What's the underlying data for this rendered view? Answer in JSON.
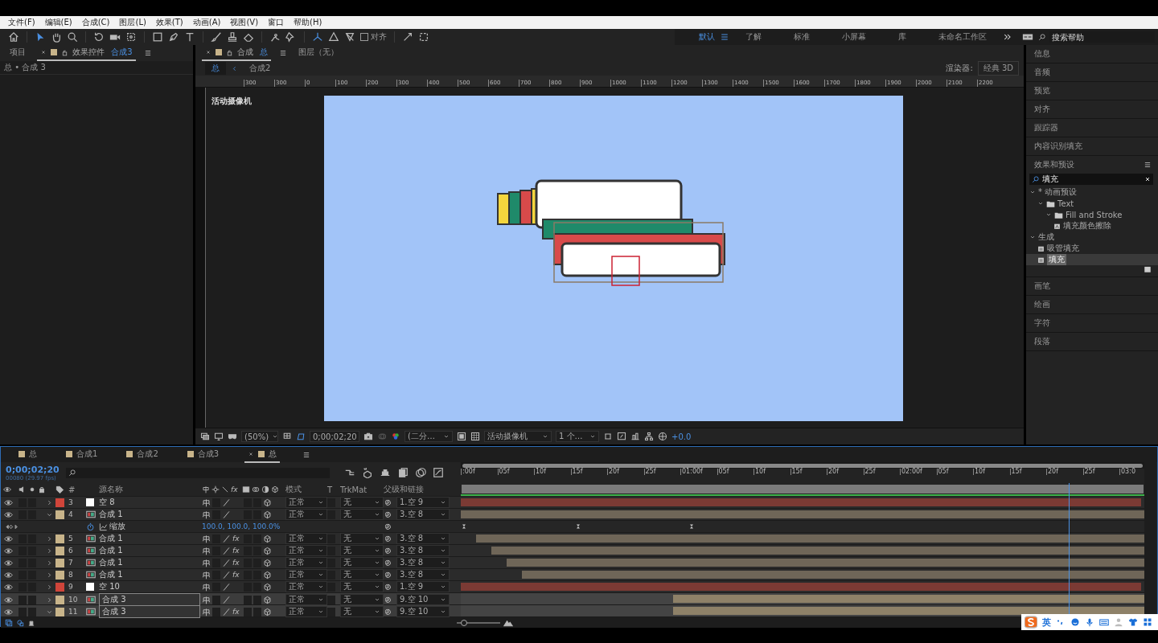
{
  "menu_bar": [
    "文件(F)",
    "编辑(E)",
    "合成(C)",
    "图层(L)",
    "效果(T)",
    "动画(A)",
    "视图(V)",
    "窗口",
    "帮助(H)"
  ],
  "toolbar": {
    "snap_label": "对齐",
    "snap_checked": false
  },
  "workspaces": [
    {
      "label": "默认",
      "selected": true
    },
    {
      "label": "了解",
      "selected": false
    },
    {
      "label": "标准",
      "selected": false
    },
    {
      "label": "小屏幕",
      "selected": false
    },
    {
      "label": "库",
      "selected": false
    },
    {
      "label": "未命名工作区",
      "selected": false
    }
  ],
  "search_help": {
    "placeholder": "搜索帮助"
  },
  "left_panel": {
    "tabs": [
      {
        "label": "项目",
        "selected": false
      },
      {
        "label": "效果控件",
        "target": "合成3",
        "selected": true
      }
    ],
    "breadcrumb": "总 • 合成 3"
  },
  "comp_panel": {
    "tabs": [
      {
        "label": "合成",
        "target": "总",
        "selected": true
      },
      {
        "label": "图层（无）",
        "selected": false
      }
    ],
    "breadcrumbs": [
      {
        "label": "总",
        "selected": true
      },
      {
        "label": "合成2",
        "selected": false
      }
    ],
    "renderer_label": "渲染器:",
    "renderer": "经典 3D",
    "ruler_labels": [
      "300",
      "300",
      "0",
      "100",
      "200",
      "300",
      "400",
      "500",
      "600",
      "700",
      "800",
      "900",
      "1000",
      "1100",
      "1200",
      "1300",
      "1400",
      "1500",
      "1600",
      "1700",
      "1800",
      "1900",
      "2000",
      "2100",
      "2200"
    ],
    "camera_label": "活动摄像机",
    "footer": {
      "zoom": "(50%)",
      "timecode": "0;00;02;20",
      "resolution": "(二分…",
      "camera": "活动摄像机",
      "views": "1 个…",
      "exposure": "+0.0"
    }
  },
  "right_panels": [
    {
      "title": "信息",
      "expanded": false
    },
    {
      "title": "音频",
      "expanded": false
    },
    {
      "title": "预览",
      "expanded": false
    },
    {
      "title": "对齐",
      "expanded": false
    },
    {
      "title": "跟踪器",
      "expanded": false
    },
    {
      "title": "内容识别填充",
      "expanded": false
    },
    {
      "title": "效果和预设",
      "expanded": true,
      "search_value": "填充",
      "tree": [
        {
          "label": "* 动画预设",
          "kind": "category",
          "expanded": true,
          "selected": false,
          "children": [
            {
              "label": "Text",
              "kind": "folder",
              "expanded": true,
              "selected": false,
              "children": [
                {
                  "label": "Fill and Stroke",
                  "kind": "folder",
                  "expanded": true,
                  "selected": false,
                  "children": [
                    {
                      "label": "填充颜色擦除",
                      "kind": "preset",
                      "selected": false
                    }
                  ]
                }
              ]
            }
          ]
        },
        {
          "label": "生成",
          "kind": "category",
          "expanded": true,
          "selected": false,
          "children": [
            {
              "label": "吸管填充",
              "kind": "effect",
              "selected": false
            },
            {
              "label": "填充",
              "kind": "effect",
              "selected": true
            }
          ]
        }
      ]
    },
    {
      "title": "画笔",
      "expanded": false
    },
    {
      "title": "绘画",
      "expanded": false
    },
    {
      "title": "字符",
      "expanded": false
    },
    {
      "title": "段落",
      "expanded": false
    }
  ],
  "timeline": {
    "tabs": [
      {
        "label": "总",
        "color": "#c8b48a",
        "selected": false
      },
      {
        "label": "合成1",
        "color": "#c8b48a",
        "selected": false
      },
      {
        "label": "合成2",
        "color": "#c8b48a",
        "selected": false
      },
      {
        "label": "合成3",
        "color": "#c8b48a",
        "selected": false
      },
      {
        "label": "总",
        "color": "#c8b48a",
        "selected": true
      }
    ],
    "timecode": "0;00;02;20",
    "frame_info": "00080 (29.97 fps)",
    "columns": {
      "number": "#",
      "source_name": "源名称",
      "fx": "fx",
      "mode": "模式",
      "t": "T",
      "trkmat": "TrkMat",
      "parent": "父级和链接"
    },
    "ruler_labels": [
      ":00f",
      "05f",
      "10f",
      "15f",
      "20f",
      "25f",
      "01:00f",
      "05f",
      "10f",
      "15f",
      "20f",
      "25f",
      "02:00f",
      "05f",
      "10f",
      "15f",
      "20f",
      "25f",
      "03:0"
    ],
    "layers": [
      {
        "number": "3",
        "color": "#d0453a",
        "kind": "null",
        "name": "空 8",
        "expanded": false,
        "selected": false,
        "mode": "正常",
        "trkmat": "无",
        "parent": "1.空 9"
      },
      {
        "number": "4",
        "color": "#c8b48a",
        "kind": "comp",
        "name": "合成 1",
        "expanded": true,
        "selected": false,
        "mode": "正常",
        "trkmat": "无",
        "parent": "3.空 8",
        "properties": [
          {
            "name": "缩放",
            "value": "100.0, 100.0, 100.0%"
          }
        ]
      },
      {
        "number": "5",
        "color": "#c8b48a",
        "kind": "comp",
        "name": "合成 1",
        "expanded": false,
        "selected": false,
        "effects": "fx",
        "mode": "正常",
        "trkmat": "无",
        "parent": "3.空 8"
      },
      {
        "number": "6",
        "color": "#c8b48a",
        "kind": "comp",
        "name": "合成 1",
        "expanded": false,
        "selected": false,
        "effects": "fx",
        "mode": "正常",
        "trkmat": "无",
        "parent": "3.空 8"
      },
      {
        "number": "7",
        "color": "#c8b48a",
        "kind": "comp",
        "name": "合成 1",
        "expanded": false,
        "selected": false,
        "effects": "fx",
        "mode": "正常",
        "trkmat": "无",
        "parent": "3.空 8"
      },
      {
        "number": "8",
        "color": "#c8b48a",
        "kind": "comp",
        "name": "合成 1",
        "expanded": false,
        "selected": false,
        "effects": "fx",
        "mode": "正常",
        "trkmat": "无",
        "parent": "3.空 8"
      },
      {
        "number": "9",
        "color": "#d0453a",
        "kind": "null",
        "name": "空 10",
        "expanded": false,
        "selected": false,
        "mode": "正常",
        "trkmat": "无",
        "parent": "1.空 9"
      },
      {
        "number": "10",
        "color": "#c8b48a",
        "kind": "comp",
        "name": "合成 3",
        "expanded": false,
        "selected": true,
        "mode": "正常",
        "trkmat": "无",
        "parent": "9.空 10"
      },
      {
        "number": "11",
        "color": "#c8b48a",
        "kind": "comp",
        "name": "合成 3",
        "expanded": true,
        "selected": true,
        "effects": "fx",
        "mode": "正常",
        "trkmat": "无",
        "parent": "9.空 10"
      }
    ],
    "zoom_slider": {
      "level": 0.1
    }
  },
  "ime_bar": {
    "mode": "英"
  }
}
